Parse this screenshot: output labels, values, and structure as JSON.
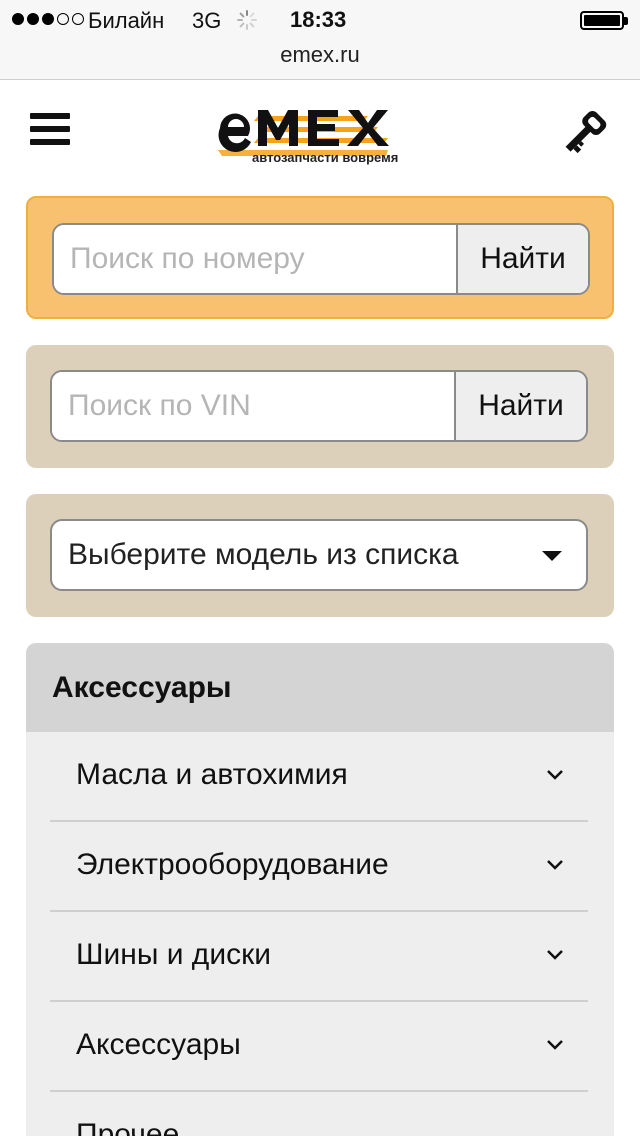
{
  "status_bar": {
    "carrier": "Билайн",
    "network": "3G",
    "time": "18:33"
  },
  "browser": {
    "url": "emex.ru"
  },
  "header": {
    "logo_text": "eMEX",
    "tagline": "автозапчасти вовремя"
  },
  "search_number": {
    "placeholder": "Поиск по номеру",
    "button_label": "Найти"
  },
  "search_vin": {
    "placeholder": "Поиск по VIN",
    "button_label": "Найти"
  },
  "model_select": {
    "selected": "Выберите модель из списка"
  },
  "categories": {
    "title": "Аксессуары",
    "items": [
      {
        "label": "Масла и автохимия"
      },
      {
        "label": "Электрооборудование"
      },
      {
        "label": "Шины и диски"
      },
      {
        "label": "Аксессуары"
      },
      {
        "label": "Прочее"
      }
    ]
  },
  "colors": {
    "orange_panel": "#f8c170",
    "beige_panel": "#dcd0ba",
    "logo_orange": "#f7a21b"
  },
  "icons": [
    "menu-icon",
    "key-icon",
    "chevron-down-icon",
    "dropdown-caret-icon",
    "loading-spinner-icon",
    "battery-icon"
  ]
}
